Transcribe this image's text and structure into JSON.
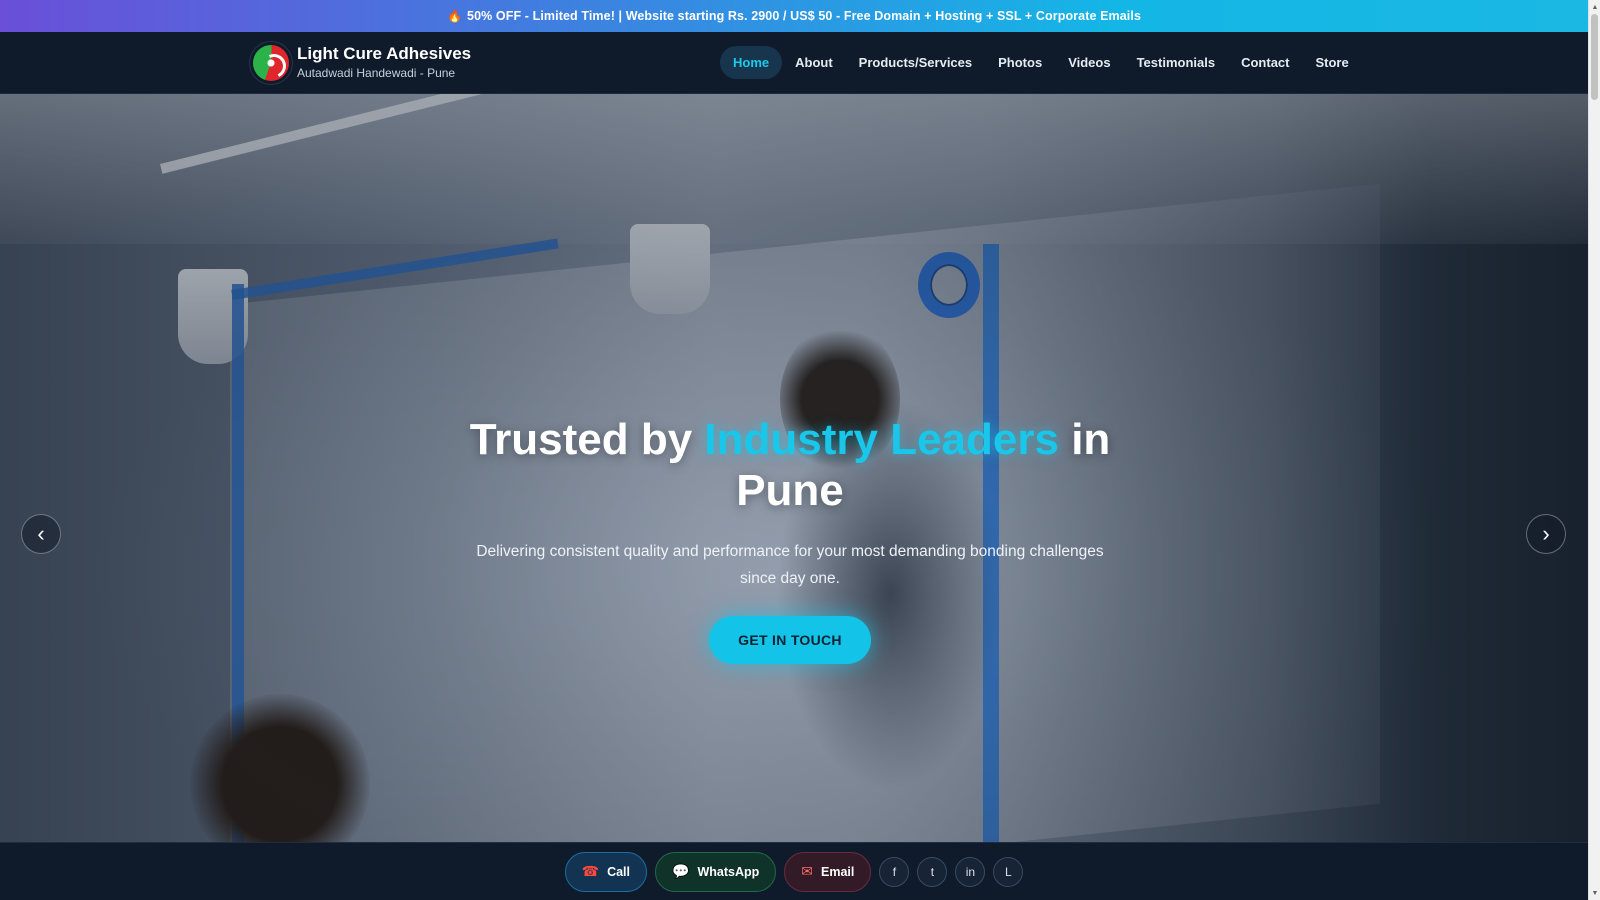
{
  "promo": {
    "icon": "fire-icon",
    "text": "50% OFF - Limited Time! | Website starting Rs. 2900 / US$ 50 - Free Domain + Hosting + SSL + Corporate Emails"
  },
  "brand": {
    "name": "Light Cure Adhesives",
    "location": "Autadwadi Handewadi - Pune"
  },
  "nav": {
    "items": [
      {
        "label": "Home",
        "active": true
      },
      {
        "label": "About"
      },
      {
        "label": "Products/Services"
      },
      {
        "label": "Photos"
      },
      {
        "label": "Videos"
      },
      {
        "label": "Testimonials"
      },
      {
        "label": "Contact"
      },
      {
        "label": "Store"
      }
    ]
  },
  "hero": {
    "title_prefix": "Trusted by ",
    "title_accent": "Industry Leaders",
    "title_suffix": " in Pune",
    "subtitle": "Delivering consistent quality and performance for your most demanding bonding challenges since day one.",
    "cta_label": "GET IN TOUCH",
    "prev_arrow": "‹",
    "next_arrow": "›"
  },
  "actions": {
    "call_label": "Call",
    "whatsapp_label": "WhatsApp",
    "email_label": "Email",
    "social": [
      "f",
      "t",
      "in",
      "L"
    ]
  },
  "colors": {
    "accent": "#19c7ea",
    "header_bg": "#0f1b2b",
    "cta_bg": "#14c3e8"
  }
}
